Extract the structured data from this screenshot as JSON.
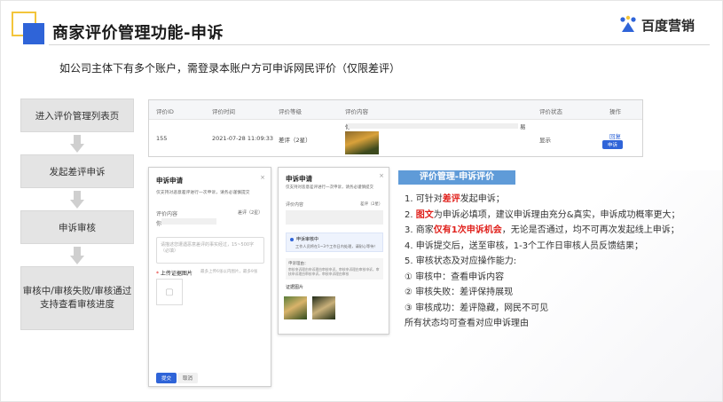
{
  "header": {
    "title": "商家评价管理功能-申诉",
    "subtitle": "如公司主体下有多个账户，需登录本账户方可申诉网民评价（仅限差评）",
    "logo_text": "百度营销"
  },
  "colors": {
    "accent_blue": "#2f64d8",
    "accent_yellow": "#f3c53b",
    "highlight_red": "#e0201b",
    "panel_head_blue": "#5f9bd8",
    "flow_box_gray": "#e4e4e4"
  },
  "flow": {
    "steps": [
      {
        "label": "进入评价管理列表页"
      },
      {
        "label": "发起差评申诉"
      },
      {
        "label": "申诉审核"
      },
      {
        "label": "审核中/审核失败/审核通过\n支持查看审核进度"
      }
    ]
  },
  "table": {
    "headers": [
      "评价ID",
      "评价时间",
      "评价等级",
      "评价内容",
      "评价状态",
      "操作"
    ],
    "row": {
      "id": "155",
      "time": "2021-07-28 11:09:33",
      "level": "差评（2星）",
      "content_prefix": "你?",
      "content_suffix": "易",
      "status": "显示",
      "action_reply": "回复",
      "action_appeal": "申诉"
    }
  },
  "modal_left": {
    "title": "申诉申请",
    "note": "仅支持对恶意差评进行一次申诉，请务必谨慎提交",
    "content_label": "评价内容",
    "rating_label": "差评（2星）",
    "content_prefix": "你",
    "textarea_placeholder": "请描述您遭遇恶意差评的事实经过，15~500字（必填）",
    "upload_label": "上传证据图片",
    "upload_hint": "最多上传6张以内图片，最多9张",
    "confirm_btn": "提交",
    "cancel_btn": "取消"
  },
  "modal_right": {
    "title": "申诉申请",
    "note": "仅支持对恶意差评进行一次申诉，请务必谨慎提交",
    "content_label": "评价内容",
    "rating_label": "差评（2星）",
    "status_title": "申诉审核中",
    "status_desc": "工作人员将在1~3个工作日内处理，请耐心等待！",
    "reason_label": "申诉理由：",
    "reason_text": "审核申诉理由申诉理由审核申诉，审核申诉理由审核申诉，审核申诉理由审核申诉，审核申诉理由审核",
    "evidence_label": "证据图片"
  },
  "right_panel": {
    "heading": "评价管理-申诉评价",
    "items": [
      {
        "pre": "1. 可针对",
        "hl": "差评",
        "post": "发起申诉；"
      },
      {
        "pre": "2. ",
        "hl": "图文",
        "post": "为申诉必填项，建议申诉理由充分&真实，申诉成功概率更大；"
      },
      {
        "pre": "3. 商家",
        "hl": "仅有1次申诉机会",
        "post": "，无论是否通过，均不可再次发起线上申诉；"
      },
      {
        "pre": "4. 申诉提交后，送至审核，1-3个工作日审核人员反馈结果；",
        "hl": "",
        "post": ""
      },
      {
        "pre": "5. 审核状态及对应操作能力:",
        "hl": "",
        "post": ""
      },
      {
        "pre": "① 审核中：查看申诉内容",
        "hl": "",
        "post": ""
      },
      {
        "pre": "② 审核失败：差评保持展现",
        "hl": "",
        "post": ""
      },
      {
        "pre": "③ 审核成功：差评隐藏，网民不可见",
        "hl": "",
        "post": ""
      },
      {
        "pre": "所有状态均可查看对应申诉理由",
        "hl": "",
        "post": ""
      }
    ]
  }
}
